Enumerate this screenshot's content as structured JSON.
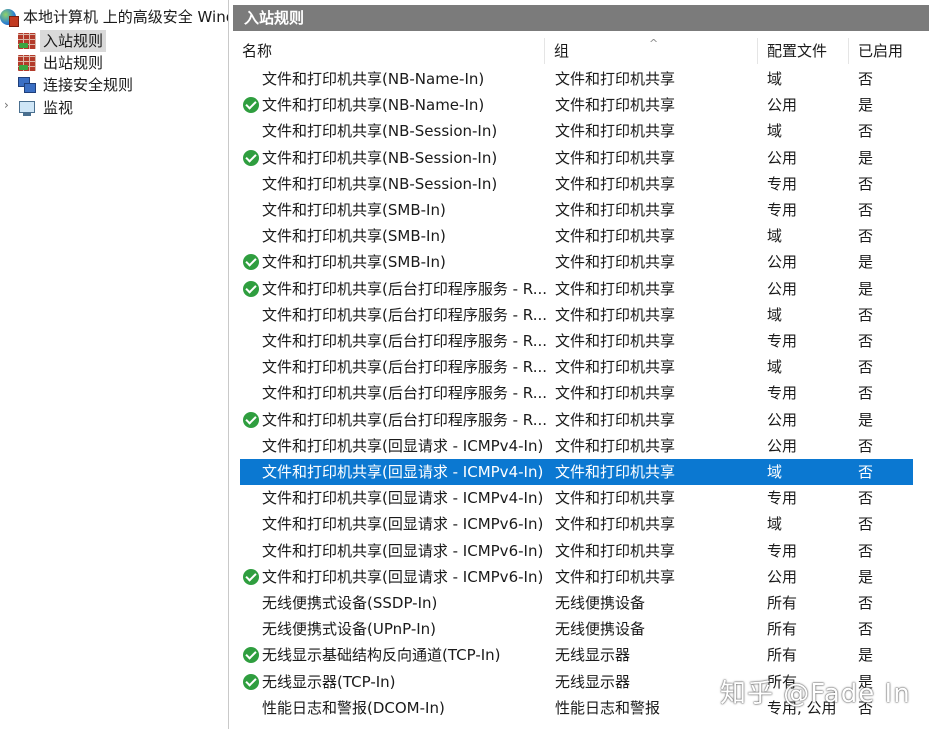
{
  "tree": {
    "root_label": "本地计算机 上的高级安全 Windows",
    "items": [
      {
        "label": "入站规则",
        "icon": "inbound-rules-icon",
        "selected": true
      },
      {
        "label": "出站规则",
        "icon": "outbound-rules-icon",
        "selected": false
      },
      {
        "label": "连接安全规则",
        "icon": "connection-security-icon",
        "selected": false
      },
      {
        "label": "监视",
        "icon": "monitor-icon",
        "selected": false
      }
    ],
    "expander": "›"
  },
  "pane": {
    "title": "入站规则",
    "columns": [
      "名称",
      "组",
      "配置文件",
      "已启用"
    ],
    "sort_indicator": "^"
  },
  "rows": [
    {
      "name": "文件和打印机共享(NB-Name-In)",
      "group": "文件和打印机共享",
      "profile": "域",
      "enabled": "否",
      "active": false
    },
    {
      "name": "文件和打印机共享(NB-Name-In)",
      "group": "文件和打印机共享",
      "profile": "公用",
      "enabled": "是",
      "active": true
    },
    {
      "name": "文件和打印机共享(NB-Session-In)",
      "group": "文件和打印机共享",
      "profile": "域",
      "enabled": "否",
      "active": false
    },
    {
      "name": "文件和打印机共享(NB-Session-In)",
      "group": "文件和打印机共享",
      "profile": "公用",
      "enabled": "是",
      "active": true
    },
    {
      "name": "文件和打印机共享(NB-Session-In)",
      "group": "文件和打印机共享",
      "profile": "专用",
      "enabled": "否",
      "active": false
    },
    {
      "name": "文件和打印机共享(SMB-In)",
      "group": "文件和打印机共享",
      "profile": "专用",
      "enabled": "否",
      "active": false
    },
    {
      "name": "文件和打印机共享(SMB-In)",
      "group": "文件和打印机共享",
      "profile": "域",
      "enabled": "否",
      "active": false
    },
    {
      "name": "文件和打印机共享(SMB-In)",
      "group": "文件和打印机共享",
      "profile": "公用",
      "enabled": "是",
      "active": true
    },
    {
      "name": "文件和打印机共享(后台打印程序服务 - R...",
      "group": "文件和打印机共享",
      "profile": "公用",
      "enabled": "是",
      "active": true
    },
    {
      "name": "文件和打印机共享(后台打印程序服务 - R...",
      "group": "文件和打印机共享",
      "profile": "域",
      "enabled": "否",
      "active": false
    },
    {
      "name": "文件和打印机共享(后台打印程序服务 - R...",
      "group": "文件和打印机共享",
      "profile": "专用",
      "enabled": "否",
      "active": false
    },
    {
      "name": "文件和打印机共享(后台打印程序服务 - R...",
      "group": "文件和打印机共享",
      "profile": "域",
      "enabled": "否",
      "active": false
    },
    {
      "name": "文件和打印机共享(后台打印程序服务 - R...",
      "group": "文件和打印机共享",
      "profile": "专用",
      "enabled": "否",
      "active": false
    },
    {
      "name": "文件和打印机共享(后台打印程序服务 - R...",
      "group": "文件和打印机共享",
      "profile": "公用",
      "enabled": "是",
      "active": true
    },
    {
      "name": "文件和打印机共享(回显请求 - ICMPv4-In)",
      "group": "文件和打印机共享",
      "profile": "公用",
      "enabled": "否",
      "active": false
    },
    {
      "name": "文件和打印机共享(回显请求 - ICMPv4-In)",
      "group": "文件和打印机共享",
      "profile": "域",
      "enabled": "否",
      "active": false,
      "selected": true
    },
    {
      "name": "文件和打印机共享(回显请求 - ICMPv4-In)",
      "group": "文件和打印机共享",
      "profile": "专用",
      "enabled": "否",
      "active": false
    },
    {
      "name": "文件和打印机共享(回显请求 - ICMPv6-In)",
      "group": "文件和打印机共享",
      "profile": "域",
      "enabled": "否",
      "active": false
    },
    {
      "name": "文件和打印机共享(回显请求 - ICMPv6-In)",
      "group": "文件和打印机共享",
      "profile": "专用",
      "enabled": "否",
      "active": false
    },
    {
      "name": "文件和打印机共享(回显请求 - ICMPv6-In)",
      "group": "文件和打印机共享",
      "profile": "公用",
      "enabled": "是",
      "active": true
    },
    {
      "name": "无线便携式设备(SSDP-In)",
      "group": "无线便携设备",
      "profile": "所有",
      "enabled": "否",
      "active": false
    },
    {
      "name": "无线便携式设备(UPnP-In)",
      "group": "无线便携设备",
      "profile": "所有",
      "enabled": "否",
      "active": false
    },
    {
      "name": "无线显示基础结构反向通道(TCP-In)",
      "group": "无线显示器",
      "profile": "所有",
      "enabled": "是",
      "active": true
    },
    {
      "name": "无线显示器(TCP-In)",
      "group": "无线显示器",
      "profile": "所有",
      "enabled": "是",
      "active": true
    },
    {
      "name": "性能日志和警报(DCOM-In)",
      "group": "性能日志和警报",
      "profile": "专用, 公用",
      "enabled": "否",
      "active": false
    }
  ],
  "watermark": "知乎 @Fade In",
  "colors": {
    "selection": "#0b78d1",
    "pane_title_bg": "#7b7b7b",
    "enabled_check": "#2f9e3f"
  }
}
